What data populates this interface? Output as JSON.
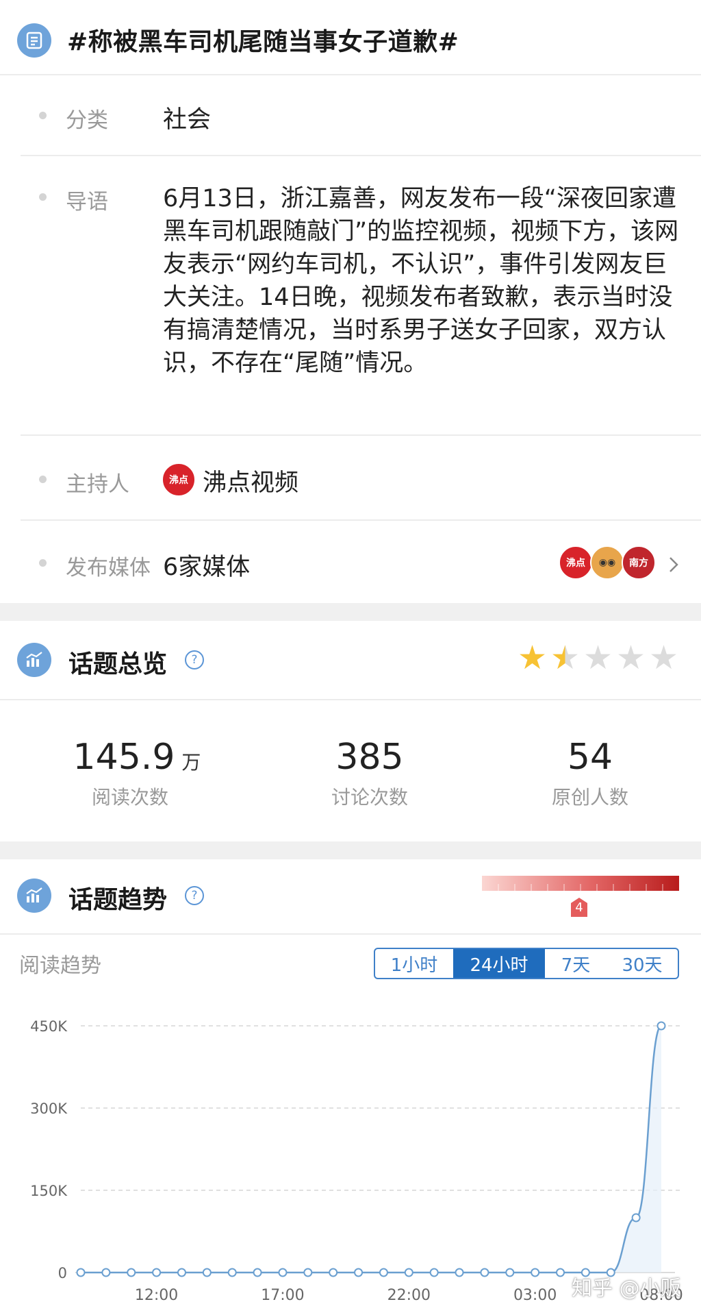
{
  "topic": {
    "title": "#称被黑车司机尾随当事女子道歉#",
    "icon": "document-list-icon"
  },
  "info": {
    "category_label": "分类",
    "category_value": "社会",
    "intro_label": "导语",
    "intro_text": "6月13日，浙江嘉善，网友发布一段“深夜回家遭黑车司机跟随敲门”的监控视频，视频下方，该网友表示“网约车司机，不认识”，事件引发网友巨大关注。14日晚，视频发布者致歉，表示当时没有搞清楚情况，当时系男子送女子回家，双方认识，不存在“尾随”情况。",
    "host_label": "主持人",
    "host_name": "沸点视频",
    "host_avatar_text": "沸点",
    "media_label": "发布媒体",
    "media_value": "6家媒体",
    "media_avatars": [
      {
        "text": "沸点",
        "color": "#d8232a"
      },
      {
        "text": "◉◉",
        "color": "#e8a54b"
      },
      {
        "text": "南方",
        "color": "#c0262d"
      }
    ]
  },
  "overview": {
    "title": "话题总览",
    "rating": 1.5,
    "rating_max": 5,
    "stats": [
      {
        "value": "145.9",
        "unit": "万",
        "label": "阅读次数"
      },
      {
        "value": "385",
        "unit": "",
        "label": "讨论次数"
      },
      {
        "value": "54",
        "unit": "",
        "label": "原创人数"
      }
    ]
  },
  "trend": {
    "title": "话题趋势",
    "heat_level": "4",
    "subtitle": "阅读趋势",
    "tabs": [
      "1小时",
      "24小时",
      "7天",
      "30天"
    ],
    "active_tab": 1
  },
  "colors": {
    "accent": "#1f6cbd",
    "icon_bg": "#6ea3da",
    "star_on": "#f7c234",
    "star_off": "#dcdcdc",
    "line": "#6a9fd0"
  },
  "watermark": "知乎 @小贩",
  "chart_data": {
    "type": "line",
    "x_tick_labels": [
      "12:00",
      "17:00",
      "22:00",
      "03:00",
      "08:00"
    ],
    "y_tick_labels": [
      "450K",
      "300K",
      "150K",
      "0"
    ],
    "ylim": [
      0,
      450000
    ],
    "x_count": 24,
    "x_tick_indices": [
      3,
      8,
      13,
      18,
      23
    ],
    "values": [
      0,
      0,
      0,
      0,
      0,
      0,
      0,
      0,
      0,
      0,
      0,
      0,
      0,
      0,
      0,
      0,
      0,
      0,
      0,
      0,
      0,
      0,
      100000,
      450000
    ],
    "grid": true
  }
}
